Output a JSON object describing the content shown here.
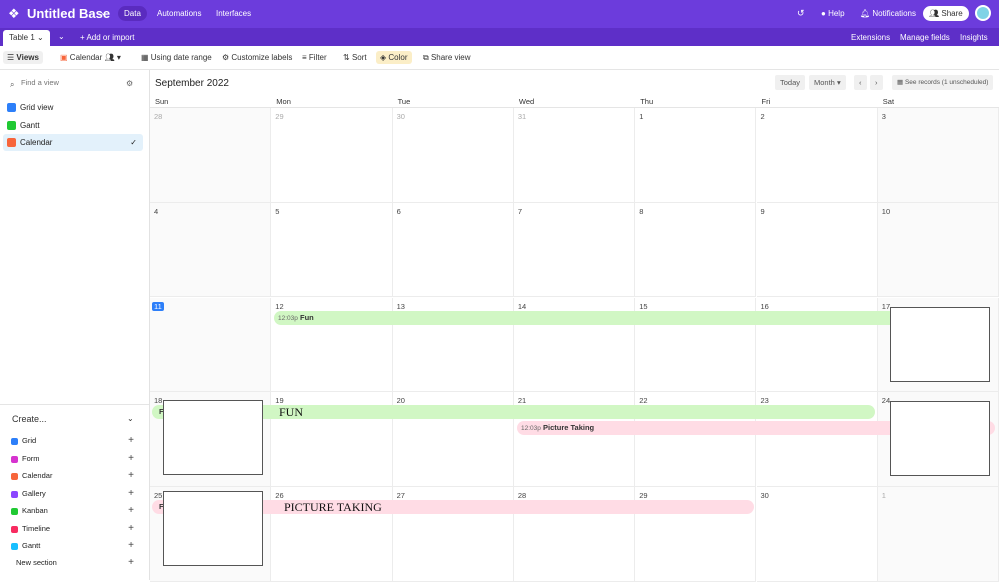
{
  "app": {
    "title": "Untitled Base",
    "nav": [
      "Data",
      "Automations",
      "Interfaces"
    ],
    "help": "Help",
    "notifications": "Notifications",
    "share": "Share"
  },
  "tabs": {
    "table": "Table 1",
    "add": "Add or import",
    "extensions": "Extensions",
    "manage_fields": "Manage fields",
    "insights": "Insights"
  },
  "toolbar": {
    "views": "Views",
    "view_name": "Calendar",
    "date_range": "Using date range",
    "customize": "Customize labels",
    "filter": "Filter",
    "sort": "Sort",
    "color": "Color",
    "share_view": "Share view"
  },
  "sidebar": {
    "search_placeholder": "Find a view",
    "views": [
      {
        "label": "Grid view",
        "color": "#2d7ff9"
      },
      {
        "label": "Gantt",
        "color": "#20c933"
      },
      {
        "label": "Calendar",
        "color": "#f82b60",
        "selected": true
      }
    ],
    "create_label": "Create...",
    "create": [
      {
        "label": "Grid",
        "color": "#2d7ff9"
      },
      {
        "label": "Form",
        "color": "#d633cf"
      },
      {
        "label": "Calendar",
        "color": "#f7653b"
      },
      {
        "label": "Gallery",
        "color": "#8b46ff"
      },
      {
        "label": "Kanban",
        "color": "#20c933"
      },
      {
        "label": "Timeline",
        "color": "#f82b60"
      },
      {
        "label": "Gantt",
        "color": "#18bfff"
      }
    ],
    "new_section": "New section"
  },
  "calendar": {
    "month": "September 2022",
    "today": "Today",
    "mode": "Month",
    "see_records": "See records (1 unscheduled)",
    "weekdays": [
      "Sun",
      "Mon",
      "Tue",
      "Wed",
      "Thu",
      "Fri",
      "Sat"
    ],
    "days": [
      "28",
      "29",
      "30",
      "31",
      "1",
      "2",
      "3",
      "4",
      "5",
      "6",
      "7",
      "8",
      "9",
      "10",
      "11",
      "12",
      "13",
      "14",
      "15",
      "16",
      "17",
      "18",
      "19",
      "20",
      "21",
      "22",
      "23",
      "24",
      "25",
      "26",
      "27",
      "28",
      "29",
      "30",
      "1"
    ],
    "events": [
      {
        "time": "12:03p",
        "title": "Fun",
        "color": "#d1f7c4"
      },
      {
        "time": "12:03p",
        "title": "Picture Taking",
        "color": "#ffdce5"
      }
    ],
    "overlays": {
      "fun": "FUN",
      "picture": "PICTURE TAKING",
      "clip": "F"
    }
  }
}
